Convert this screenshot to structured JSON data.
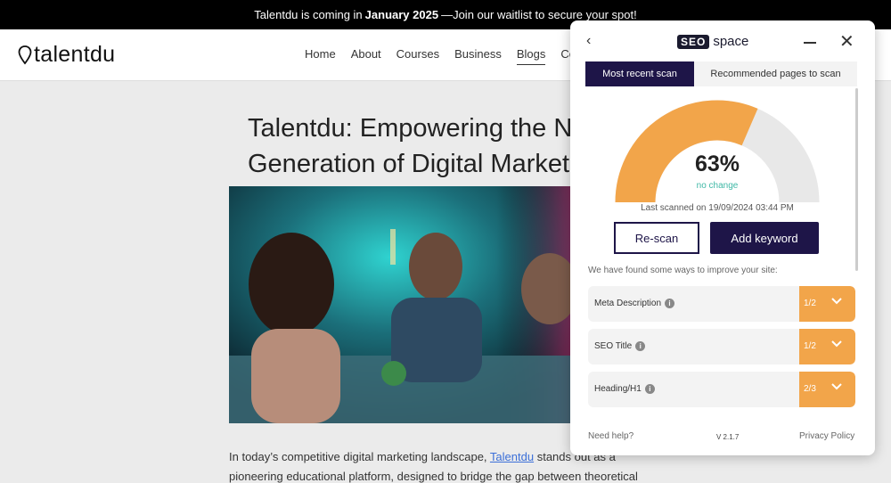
{
  "announcement": {
    "prefix": "Talentdu is coming in",
    "highlight": "January 2025",
    "suffix": "—Join our waitlist to secure your spot!"
  },
  "site": {
    "logo_text": "talentdu",
    "nav": [
      "Home",
      "About",
      "Courses",
      "Business",
      "Blogs",
      "Contact"
    ],
    "active_nav": "Blogs"
  },
  "article": {
    "title": "Talentdu: Empowering the Next Generation of Digital Marketers",
    "intro_before": "In today’s competitive digital marketing landscape,",
    "intro_link": "Talentdu",
    "intro_after": "stands out as a pioneering educational platform, designed to bridge the gap between theoretical"
  },
  "panel": {
    "brand_badge": "SEO",
    "brand_text": "space",
    "tabs": {
      "active": "Most recent scan",
      "inactive": "Recommended pages to scan"
    },
    "score": {
      "value": "63%",
      "percent": 63,
      "change": "no change"
    },
    "last_scanned": "Last scanned on 19/09/2024 03:44 PM",
    "rescan_label": "Re-scan",
    "add_keyword_label": "Add keyword",
    "improve_text": "We have found some ways to improve your site:",
    "issues": [
      {
        "label": "Meta Description",
        "score": "1/2"
      },
      {
        "label": "SEO Title",
        "score": "1/2"
      },
      {
        "label": "Heading/H1",
        "score": "2/3"
      }
    ],
    "footer": {
      "help": "Need help?",
      "version": "V 2.1.7",
      "privacy": "Privacy Policy"
    },
    "colors": {
      "accent": "#1e1548",
      "gauge_fill": "#f2a54a",
      "gauge_track": "#e8e8e8",
      "status": "#3fb8a6"
    }
  }
}
